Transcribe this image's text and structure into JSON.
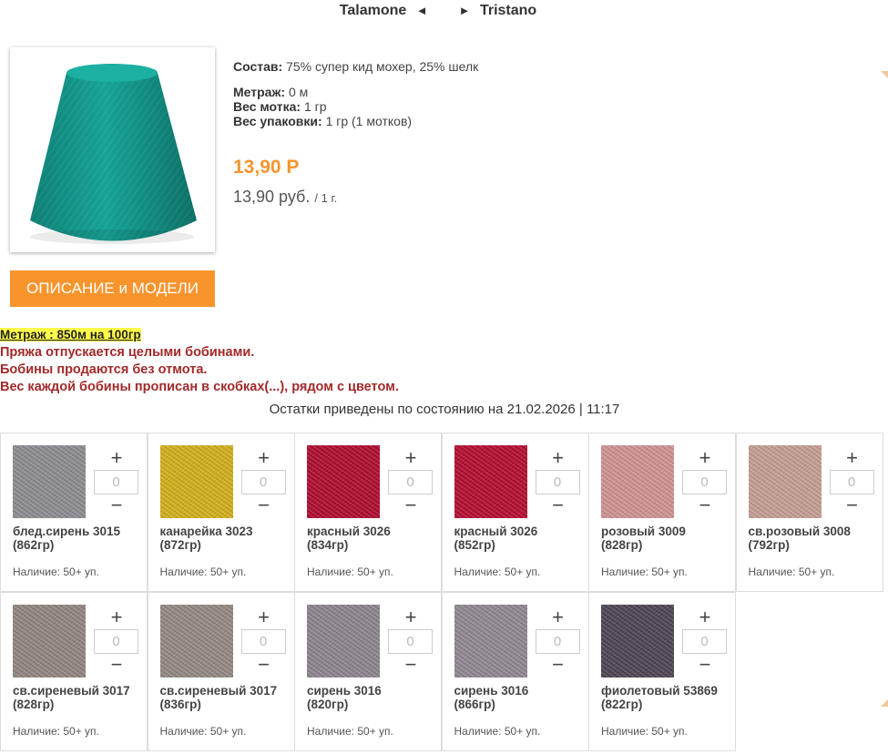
{
  "nav": {
    "prev": "Talamone",
    "prev_arrow": "◄",
    "next_arrow": "►",
    "next": "Tristano"
  },
  "product": {
    "composition_label": "Состав:",
    "composition_value": "75% супер кид мохер, 25% шелк",
    "length_label": "Метраж:",
    "length_value": "0 м",
    "skein_weight_label": "Вес мотка:",
    "skein_weight_value": "1 гр",
    "pack_weight_label": "Вес упаковки:",
    "pack_weight_value": "1 гр (1 мотков)",
    "price": "13,90 Р",
    "price_rub": "13,90 руб.",
    "price_unit": "/ 1 г.",
    "description_button": "ОПИСАНИЕ и МОДЕЛИ",
    "image_color": "#14968a"
  },
  "notice": {
    "meter": "Метраж : 850м на 100гр",
    "line1": "Пряжа отпускается целыми бобинами.",
    "line2": "Бобины продаются без отмота.",
    "line3": "Вес каждой бобины прописан в скобках(...), рядом с цветом."
  },
  "stock_date": "Остатки приведены по состоянию на 21.02.2026 | 11:17",
  "plus_symbol": "+",
  "minus_symbol": "−",
  "colors": [
    {
      "name": "блед.сирень 3015",
      "weight": "(862гр)",
      "availability": "Наличие: 50+ уп.",
      "qty": "0",
      "swatch": "#8e8e94"
    },
    {
      "name": "канарейка 3023",
      "weight": "(872гр)",
      "availability": "Наличие: 50+ уп.",
      "qty": "0",
      "swatch": "#d6b21a"
    },
    {
      "name": "красный 3026",
      "weight": "(834гр)",
      "availability": "Наличие: 50+ уп.",
      "qty": "0",
      "swatch": "#b20b2f"
    },
    {
      "name": "красный 3026",
      "weight": "(852гр)",
      "availability": "Наличие: 50+ уп.",
      "qty": "0",
      "swatch": "#b80c30"
    },
    {
      "name": "розовый 3009",
      "weight": "(828гр)",
      "availability": "Наличие: 50+ уп.",
      "qty": "0",
      "swatch": "#d39595"
    },
    {
      "name": "св.розовый 3008",
      "weight": "(792гр)",
      "availability": "Наличие: 50+ уп.",
      "qty": "0",
      "swatch": "#c8a194"
    },
    {
      "name": "св.сиреневый 3017",
      "weight": "(828гр)",
      "availability": "Наличие: 50+ уп.",
      "qty": "0",
      "swatch": "#938782"
    },
    {
      "name": "св.сиреневый 3017",
      "weight": "(836гр)",
      "availability": "Наличие: 50+ уп.",
      "qty": "0",
      "swatch": "#968a85"
    },
    {
      "name": "сирень 3016",
      "weight": "(820гр)",
      "availability": "Наличие: 50+ уп.",
      "qty": "0",
      "swatch": "#8f8690"
    },
    {
      "name": "сирень 3016",
      "weight": "(866гр)",
      "availability": "Наличие: 50+ уп.",
      "qty": "0",
      "swatch": "#928993"
    },
    {
      "name": "фиолетовый 53869",
      "weight": "(822гр)",
      "availability": "Наличие: 50+ уп.",
      "qty": "0",
      "swatch": "#4f4554"
    }
  ]
}
